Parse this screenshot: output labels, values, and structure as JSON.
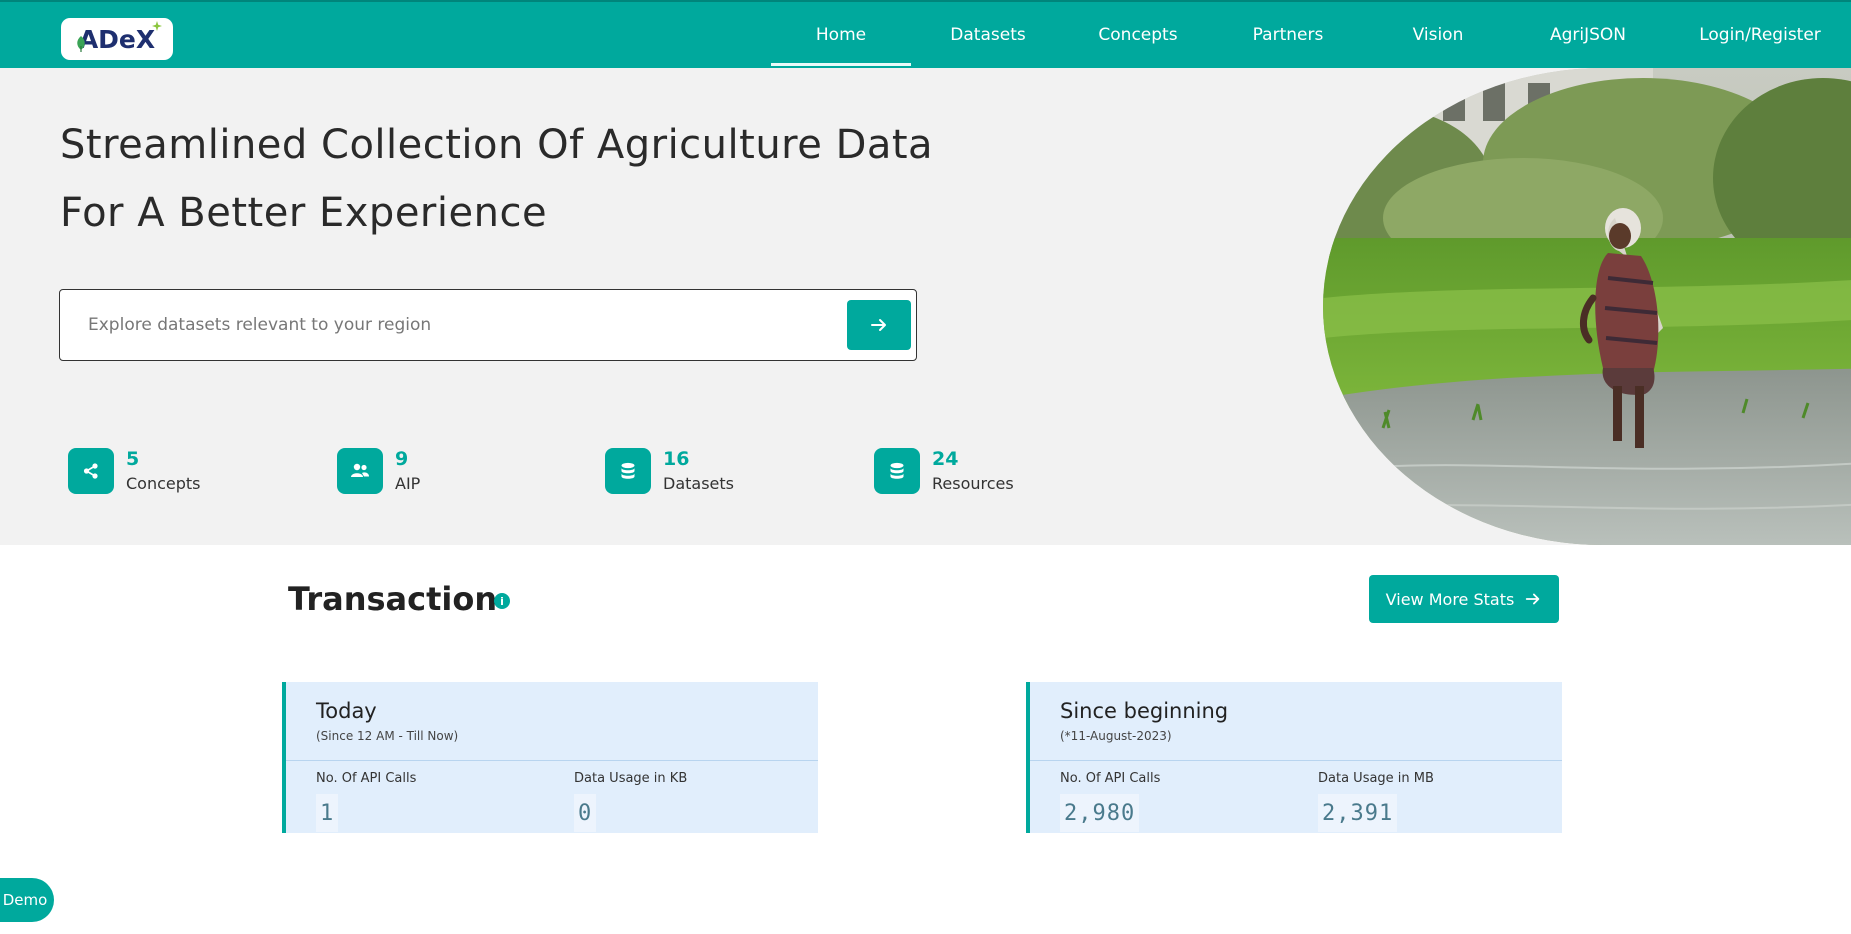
{
  "brand": {
    "logo_text": "ADeX",
    "brand_color": "#00a99d",
    "logo_color": "#1e2f6f"
  },
  "nav": {
    "items": [
      {
        "label": "Home",
        "active": true
      },
      {
        "label": "Datasets"
      },
      {
        "label": "Concepts"
      },
      {
        "label": "Partners"
      },
      {
        "label": "Vision"
      },
      {
        "label": "AgriJSON"
      },
      {
        "label": "Login/Register"
      }
    ]
  },
  "hero": {
    "title_line1": "Streamlined Collection Of Agriculture Data",
    "title_line2": "For A Better Experience",
    "search": {
      "placeholder": "Explore datasets relevant to your region",
      "value": "",
      "button_icon": "arrow-right-icon"
    },
    "stats": [
      {
        "value": "5",
        "label": "Concepts",
        "icon": "share-icon"
      },
      {
        "value": "9",
        "label": "AIP",
        "icon": "users-icon"
      },
      {
        "value": "16",
        "label": "Datasets",
        "icon": "database-icon"
      },
      {
        "value": "24",
        "label": "Resources",
        "icon": "database-icon"
      }
    ],
    "image": "woman-planting-rice-in-paddy-field"
  },
  "transaction": {
    "title": "Transaction",
    "info_icon": "i",
    "view_more_label": "View More Stats",
    "cards": [
      {
        "title": "Today",
        "subtitle": "(Since 12 AM - Till Now)",
        "metrics": [
          {
            "label": "No. Of API Calls",
            "value": "1"
          },
          {
            "label": "Data Usage in KB",
            "value": "0"
          }
        ]
      },
      {
        "title": "Since beginning",
        "subtitle": "(*11-August-2023)",
        "metrics": [
          {
            "label": "No. Of API Calls",
            "value": "2,980"
          },
          {
            "label": "Data Usage in MB",
            "value": "2,391"
          }
        ]
      }
    ]
  },
  "demo_button_label": "Demo"
}
